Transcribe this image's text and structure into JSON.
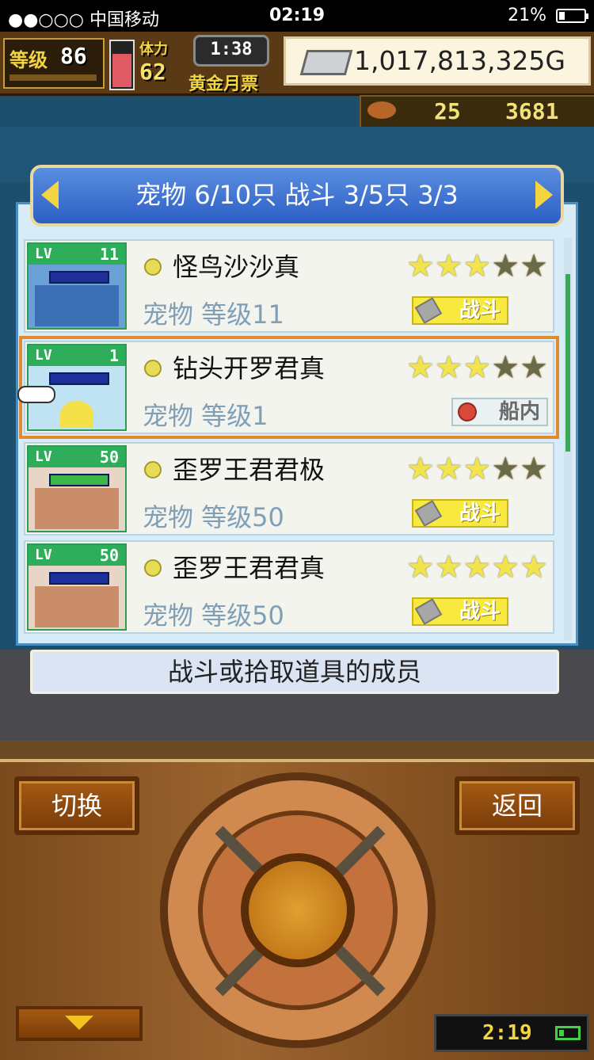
{
  "status_bar": {
    "carrier": "●●○○○ 中国移动",
    "time": "02:19",
    "battery": "21%"
  },
  "hud": {
    "level_label": "等级",
    "level_value": "86",
    "stamina_label": "体力",
    "stamina_value": "62",
    "timer": "1:38",
    "gold_pass": "黄金月票",
    "money": "1,017,813,325G",
    "food_count": "25",
    "medal_count": "3681"
  },
  "panel": {
    "header": "宠物 6/10只 战斗 3/5只  3/3",
    "rows": [
      {
        "lv": "LV",
        "level": "11",
        "name": "怪鸟沙沙真",
        "sub": "宠物 等级11",
        "stars": 3,
        "tag": "战斗"
      },
      {
        "lv": "LV",
        "level": "1",
        "name": "钻头开罗君真",
        "sub": "宠物 等级1",
        "stars": 3,
        "tag": "船内"
      },
      {
        "lv": "LV",
        "level": "50",
        "name": "歪罗王君君极",
        "sub": "宠物 等级50",
        "stars": 3,
        "tag": "战斗"
      },
      {
        "lv": "LV",
        "level": "50",
        "name": "歪罗王君君真",
        "sub": "宠物 等级50",
        "stars": 5,
        "tag": "战斗"
      }
    ],
    "caption": "战斗或拾取道具的成员"
  },
  "controls": {
    "switch_label": "切换",
    "back_label": "返回",
    "clock": "2:19"
  },
  "colors": {
    "accent": "#2c5fc4",
    "selected_outline": "#e18b2e",
    "star_on": "#f1e44c",
    "star_off": "#6b6b4a"
  }
}
